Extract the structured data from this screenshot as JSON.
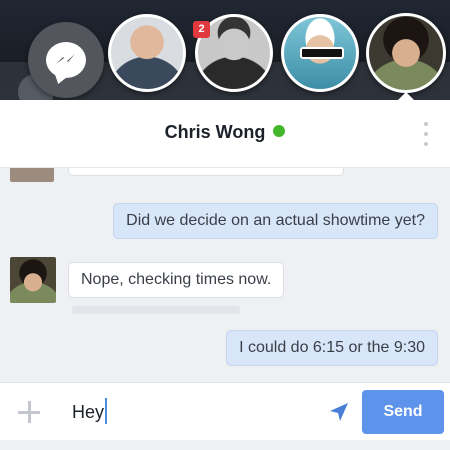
{
  "chat_heads": [
    {
      "name": "messenger",
      "icon": "messenger-icon"
    },
    {
      "name": "contact-1"
    },
    {
      "name": "contact-2",
      "badge": "2"
    },
    {
      "name": "contact-3"
    },
    {
      "name": "chris-wong",
      "active": true
    }
  ],
  "conversation": {
    "title": "Chris Wong",
    "status_color": "#42b72a",
    "messages": [
      {
        "direction": "out",
        "text": "Did we decide on an actual showtime yet?"
      },
      {
        "direction": "in",
        "text": "Nope, checking times now."
      },
      {
        "direction": "out",
        "text": "I could do 6:15 or the 9:30"
      }
    ]
  },
  "composer": {
    "value": "Hey",
    "send_label": "Send",
    "accent": "#5d93ea"
  }
}
